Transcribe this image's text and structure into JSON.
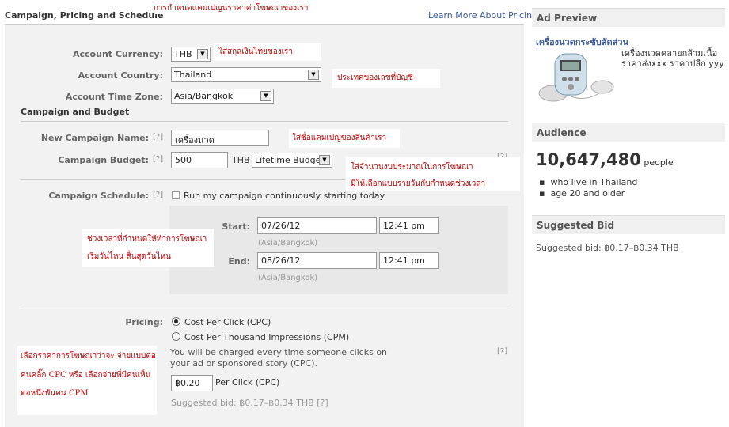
{
  "header": {
    "title": "Campaign, Pricing and Schedule",
    "note": "การกำหนดแคมเปญนราคาค่าโฆษณาของเรา",
    "learn_more": "Learn More About Pricing"
  },
  "account": {
    "currency_label": "Account Currency:",
    "currency_value": "THB",
    "currency_note": "ใส่สกุลเงินไทยของเรา",
    "country_label": "Account Country:",
    "country_value": "Thailand",
    "country_note": "ประเทศของเลขที่บัญชี",
    "timezone_label": "Account Time Zone:",
    "timezone_value": "Asia/Bangkok"
  },
  "campaign": {
    "section_title": "Campaign and Budget",
    "name_label": "New Campaign Name:",
    "name_value": "เครื่องนวด",
    "name_note": "ใส่ชื่อแคมเปญของสินค้าเรา",
    "budget_label": "Campaign Budget:",
    "budget_value": "500",
    "budget_currency": "THB",
    "budget_type": "Lifetime Budget",
    "budget_note_1": "ใส่จำนวนงบประมาณในการโฆษณา",
    "budget_note_2": "มีให้เลือกแบบรายวันกับกำหนดช่วงเวลา",
    "help": "[?]"
  },
  "schedule": {
    "label": "Campaign Schedule:",
    "checkbox_label": "Run my campaign continuously starting today",
    "start_label": "Start:",
    "start_date": "07/26/12",
    "start_time": "12:41 pm",
    "end_label": "End:",
    "end_date": "08/26/12",
    "end_time": "12:41 pm",
    "tz": "(Asia/Bangkok)",
    "note_1": "ช่วงเวลาที่กำหนดให้ทำการโฆษณา",
    "note_2": "เริ่มวันไหน สิ้นสุดวันไหน"
  },
  "pricing": {
    "label": "Pricing:",
    "cpc": "Cost Per Click (CPC)",
    "cpm": "Cost Per Thousand Impressions (CPM)",
    "desc": "You will be charged every time someone clicks on your ad or sponsored story (CPC).",
    "bid_value": "฿0.20",
    "bid_unit": "Per Click (CPC)",
    "suggested": "Suggested bid: ฿0.17–฿0.34 THB",
    "note_1": "เลือกราคาการโฆษณาว่าจะ จ่ายแบบต่อ",
    "note_2": "คนคลิ๊ก CPC หรือ เลือกจ่ายที่มีคนเห็น",
    "note_3": "ต่อหนึ่งพันคน CPM"
  },
  "ad_preview": {
    "header": "Ad Preview",
    "title": "เครื่องนวดกระชับสัดส่วน",
    "body_1": "เครื่องนวดคลายกล้ามเนื้อ",
    "body_2": "ราคาส่งxxx ราคาปลีก yyy"
  },
  "audience": {
    "header": "Audience",
    "count": "10,647,480",
    "unit": "people",
    "bullet_1": "who live in Thailand",
    "bullet_2": "age 20 and older"
  },
  "suggested_bid": {
    "header": "Suggested Bid",
    "text": "Suggested bid: ฿0.17–฿0.34 THB"
  },
  "icons": [
    "dropdown-arrow-icon",
    "checkbox-icon",
    "radio-icon",
    "massager-device-icon"
  ]
}
